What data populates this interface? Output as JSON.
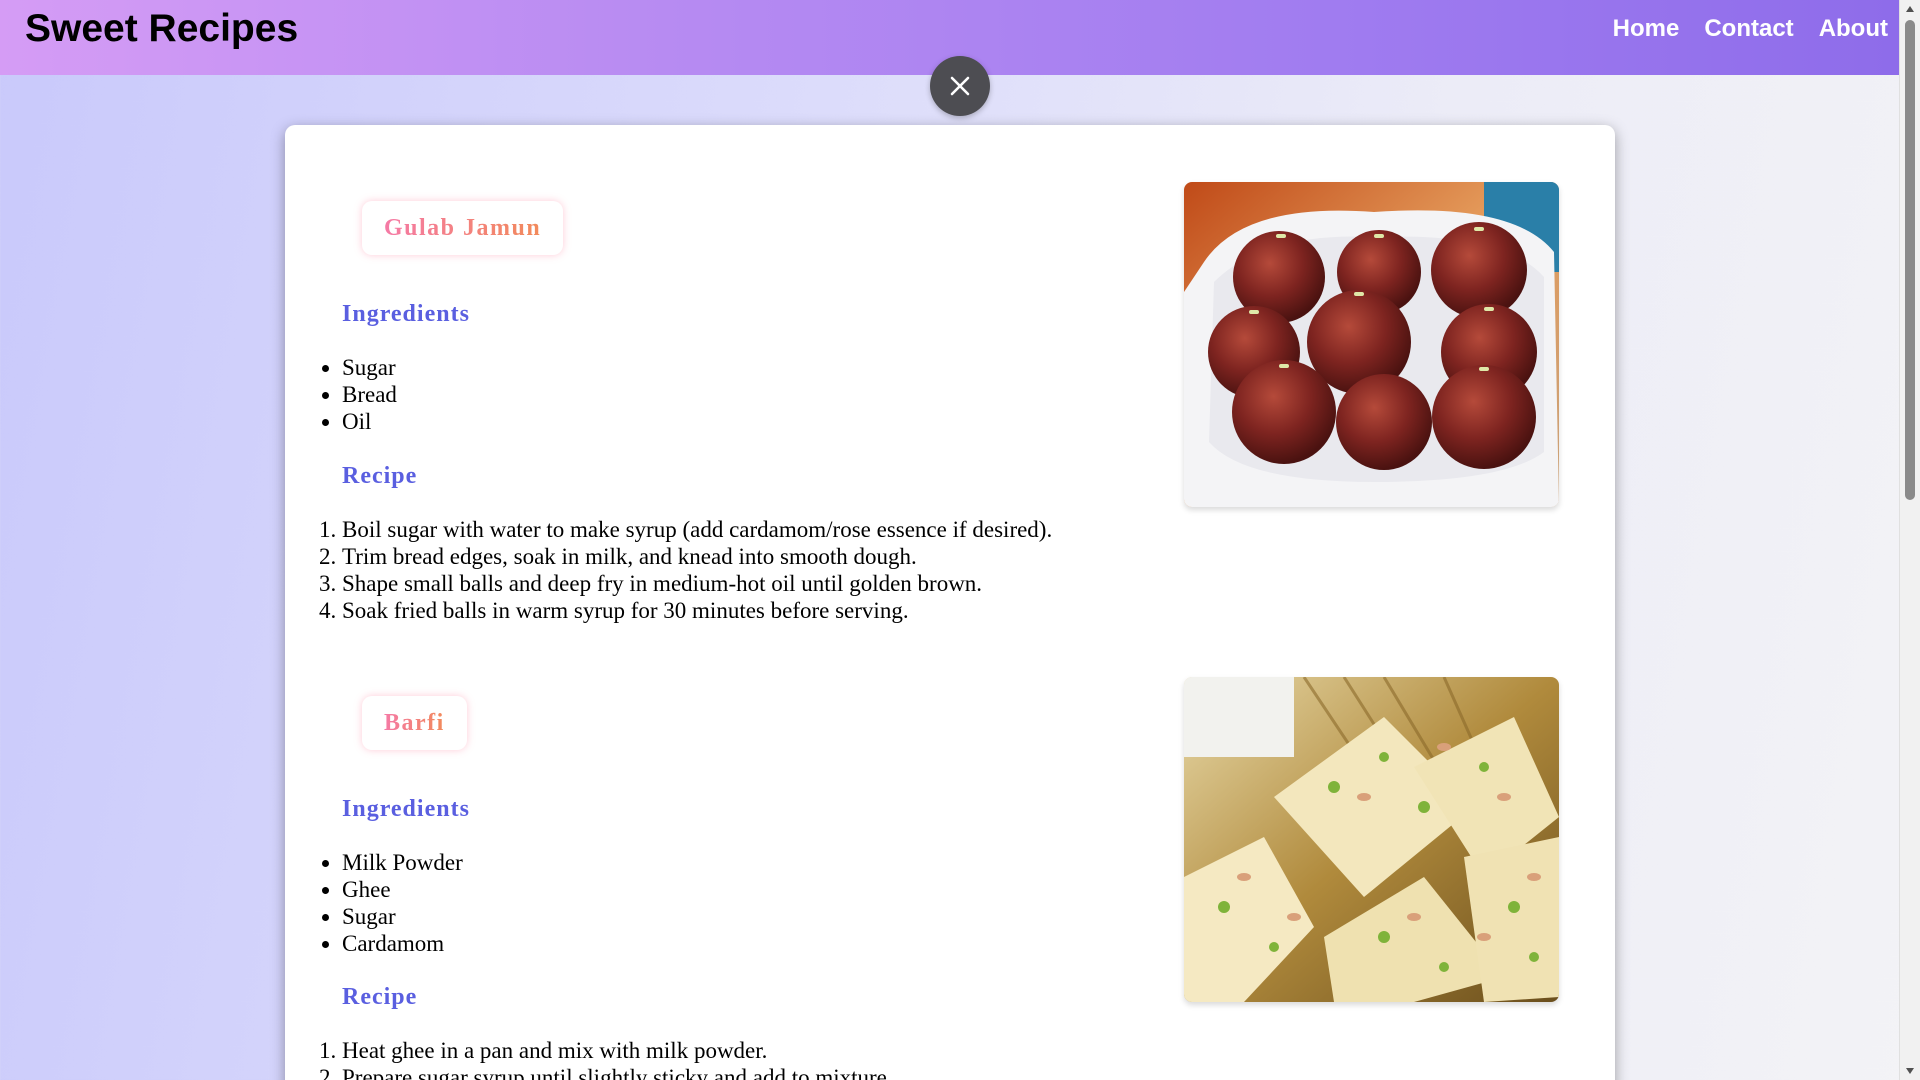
{
  "header": {
    "brand": "Sweet Recipes",
    "nav": [
      "Home",
      "Contact",
      "About"
    ]
  },
  "close_button": {
    "icon": "close-icon"
  },
  "recipes": [
    {
      "title": "Gulab Jamun",
      "ingredients_heading": "Ingredients",
      "ingredients": [
        "Sugar",
        "Bread",
        "Oil"
      ],
      "recipe_heading": "Recipe",
      "steps": [
        "Boil sugar with water to make syrup (add cardamom/rose essence if desired).",
        "Trim bread edges, soak in milk, and knead into smooth dough.",
        "Shape small balls and deep fry in medium-hot oil until golden brown.",
        "Soak fried balls in warm syrup for 30 minutes before serving."
      ]
    },
    {
      "title": "Barfi",
      "ingredients_heading": "Ingredients",
      "ingredients": [
        "Milk Powder",
        "Ghee",
        "Sugar",
        "Cardamom"
      ],
      "recipe_heading": "Recipe",
      "steps": [
        "Heat ghee in a pan and mix with milk powder.",
        "Prepare sugar syrup until slightly sticky and add to mixture."
      ]
    }
  ],
  "colors": {
    "heading": "#5a5fe0",
    "title_gradient_start": "#f57aa6",
    "title_gradient_end": "#f28a5a",
    "header_gradient_start": "#d59cf5",
    "header_gradient_end": "#8e6cea"
  }
}
